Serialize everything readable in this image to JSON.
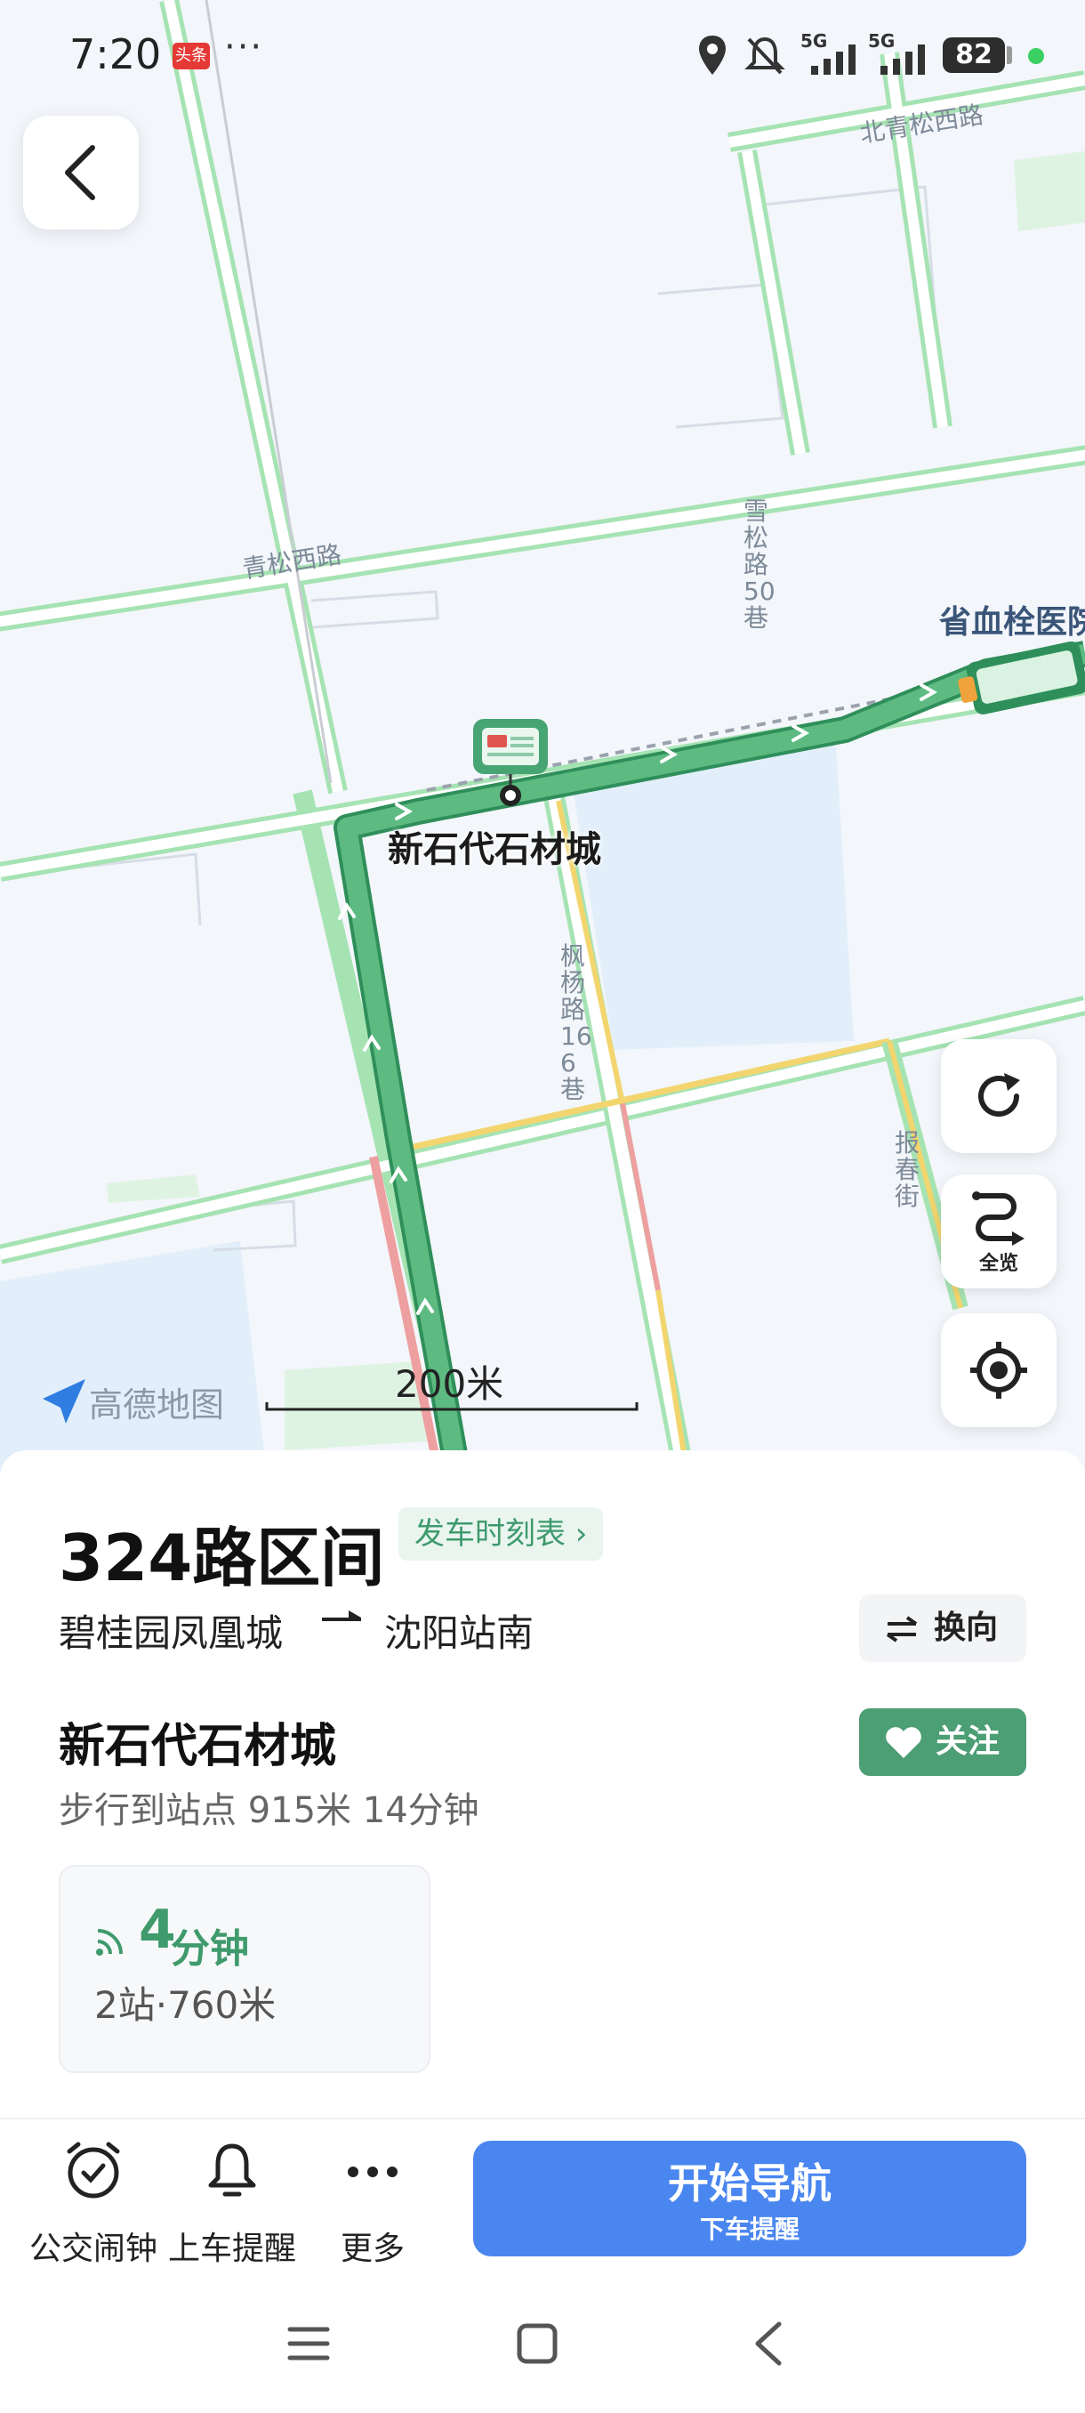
{
  "status_bar": {
    "time": "7:20",
    "badge": "头条",
    "more": "···",
    "network1": "5G",
    "network2": "5G",
    "battery": "82"
  },
  "map": {
    "road_labels": {
      "beiqingsong": "北青松西路",
      "qingsong": "青松西路",
      "xuesong": "雪松路50巷",
      "fengyang": "枫杨路166巷",
      "baochun": "报春街"
    },
    "poi_label": "省血栓医院",
    "stop_label": "新石代石材城",
    "scale": "200米",
    "brand": "高德地图",
    "overview_label": "全览"
  },
  "route": {
    "name": "324路区间",
    "schedule_label": "发车时刻表 ›",
    "from": "碧桂园凤凰城",
    "to": "沈阳站南",
    "switch_label": "换向",
    "stop_name": "新石代石材城",
    "follow_label": "关注",
    "walk_info": "步行到站点 915米 14分钟",
    "eta_number": "4",
    "eta_unit": "分钟",
    "eta_detail": "2站·760米"
  },
  "actions": {
    "alarm_label": "公交闹钟",
    "reminder_label": "上车提醒",
    "more_label": "更多",
    "navigate_label": "开始导航",
    "navigate_sub": "下车提醒"
  },
  "colors": {
    "route_green": "#4fae78",
    "accent_blue": "#4a86f0",
    "follow_green": "#4c9e74"
  }
}
